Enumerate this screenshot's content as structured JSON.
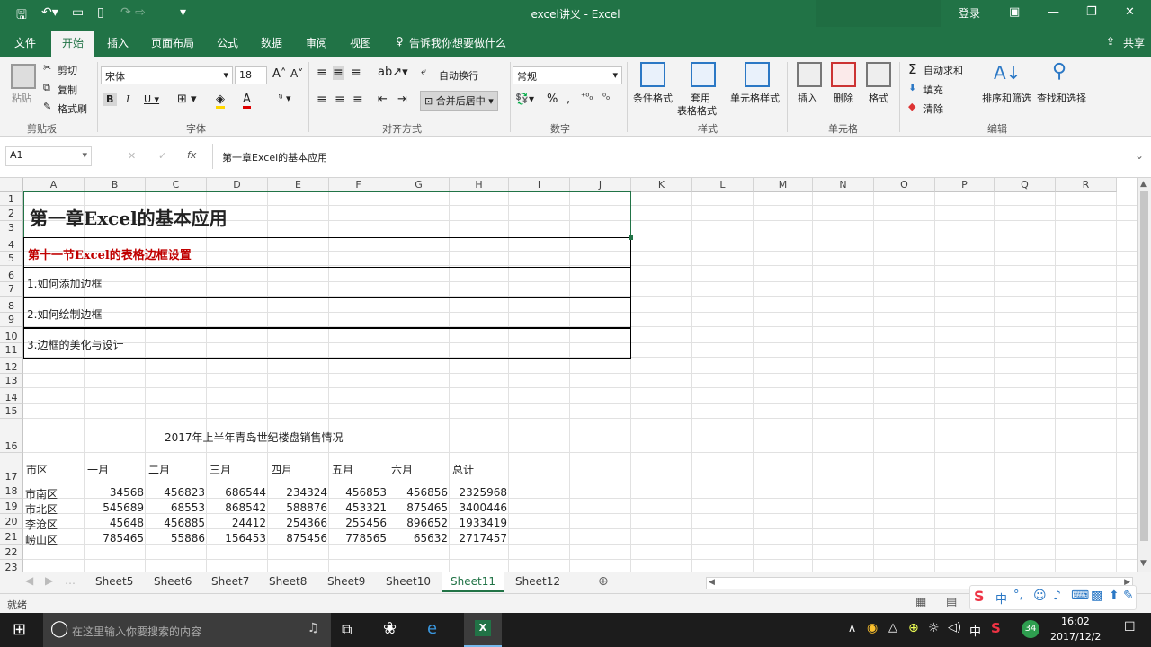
{
  "window": {
    "title": "excel讲义  -  Excel",
    "login": "登录",
    "share": "共享"
  },
  "menu": {
    "tabs": [
      "文件",
      "开始",
      "插入",
      "页面布局",
      "公式",
      "数据",
      "审阅",
      "视图"
    ],
    "tell": "告诉我你想要做什么"
  },
  "ribbon": {
    "clipboard": {
      "paste": "粘贴",
      "cut": "剪切",
      "copy": "复制",
      "painter": "格式刷",
      "group": "剪贴板"
    },
    "font": {
      "name": "宋体",
      "size": "18",
      "group": "字体"
    },
    "align": {
      "wrap": "自动换行",
      "merge": "合并后居中",
      "group": "对齐方式"
    },
    "number": {
      "format": "常规",
      "group": "数字"
    },
    "styles": {
      "cond": "条件格式",
      "table": "套用",
      "table2": "表格格式",
      "cell": "单元格样式",
      "group": "样式"
    },
    "cells": {
      "insert": "插入",
      "delete": "删除",
      "format": "格式",
      "group": "单元格"
    },
    "edit": {
      "autosum": "自动求和",
      "fill": "填充",
      "clear": "清除",
      "sort": "排序和筛选",
      "find": "查找和选择",
      "group": "编辑"
    }
  },
  "formula": {
    "namebox": "A1",
    "content": "第一章Excel的基本应用"
  },
  "columns": [
    "A",
    "B",
    "C",
    "D",
    "E",
    "F",
    "G",
    "H",
    "I",
    "J",
    "K",
    "L",
    "M",
    "N",
    "O",
    "P",
    "Q",
    "R"
  ],
  "rows": [
    "1",
    "2",
    "3",
    "4",
    "5",
    "6",
    "7",
    "8",
    "9",
    "10",
    "11",
    "12",
    "13",
    "14",
    "15",
    "16",
    "17",
    "18",
    "19",
    "20",
    "21",
    "22",
    "23"
  ],
  "content": {
    "title": "第一章Excel的基本应用",
    "section": "第十一节Excel的表格边框设置",
    "item1": "1.如何添加边框",
    "item2": "2.如何绘制边框",
    "item3": "3.边框的美化与设计"
  },
  "table": {
    "title": "2017年上半年青岛世纪楼盘销售情况",
    "headers": [
      "市区",
      "一月",
      "二月",
      "三月",
      "四月",
      "五月",
      "六月",
      "总计"
    ],
    "rows": [
      [
        "市南区",
        "34568",
        "456823",
        "686544",
        "234324",
        "456853",
        "456856",
        "2325968"
      ],
      [
        "市北区",
        "545689",
        "68553",
        "868542",
        "588876",
        "453321",
        "875465",
        "3400446"
      ],
      [
        "李沧区",
        "45648",
        "456885",
        "24412",
        "254366",
        "255456",
        "896652",
        "1933419"
      ],
      [
        "崂山区",
        "785465",
        "55886",
        "156453",
        "875456",
        "778565",
        "65632",
        "2717457"
      ]
    ]
  },
  "sheets": [
    "Sheet5",
    "Sheet6",
    "Sheet7",
    "Sheet8",
    "Sheet9",
    "Sheet10",
    "Sheet11",
    "Sheet12"
  ],
  "status": {
    "ready": "就绪"
  },
  "taskbar": {
    "search": "在这里输入你要搜索的内容",
    "time": "16:02",
    "date": "2017/12/2",
    "ime": "中"
  }
}
